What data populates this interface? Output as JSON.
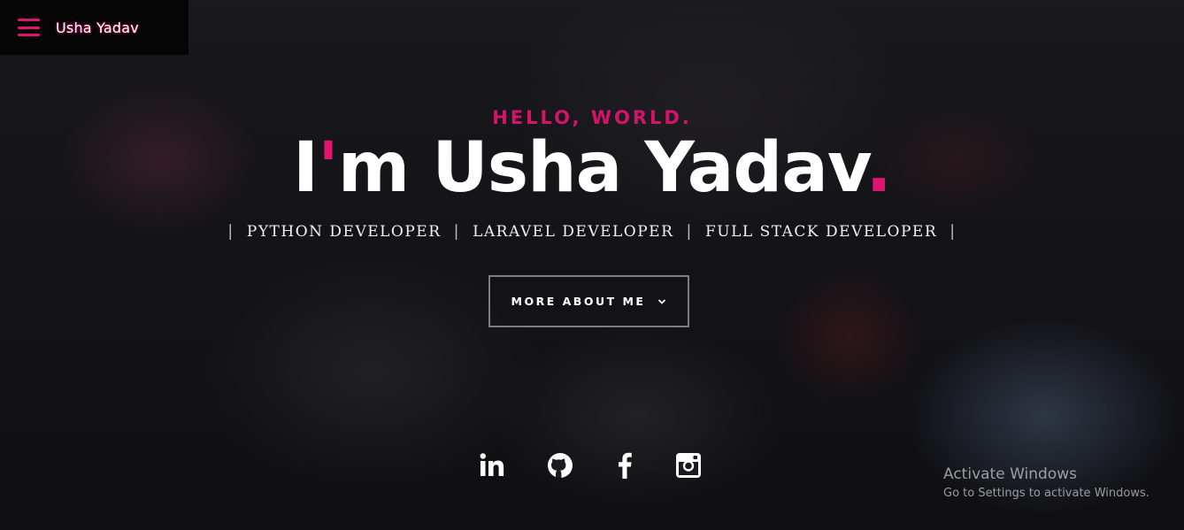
{
  "brand": {
    "name": "Usha Yadav",
    "menu_icon": "hamburger-menu-icon",
    "accent_color": "#e0166e"
  },
  "hero": {
    "greeting": "HELLO, WORLD.",
    "title_prefix_i": "I",
    "title_apostrophe": "'",
    "title_rest": "m Usha Yadav",
    "title_dot": ".",
    "roles": [
      "PYTHON DEVELOPER",
      "LARAVEL DEVELOPER",
      "FULL STACK DEVELOPER"
    ],
    "role_separator": "|",
    "more_button_label": "MORE ABOUT ME",
    "more_button_icon": "chevron-down-icon"
  },
  "socials": [
    {
      "icon": "linkedin-icon"
    },
    {
      "icon": "github-icon"
    },
    {
      "icon": "facebook-icon"
    },
    {
      "icon": "instagram-icon"
    }
  ],
  "watermark": {
    "title": "Activate Windows",
    "subtitle": "Go to Settings to activate Windows."
  }
}
